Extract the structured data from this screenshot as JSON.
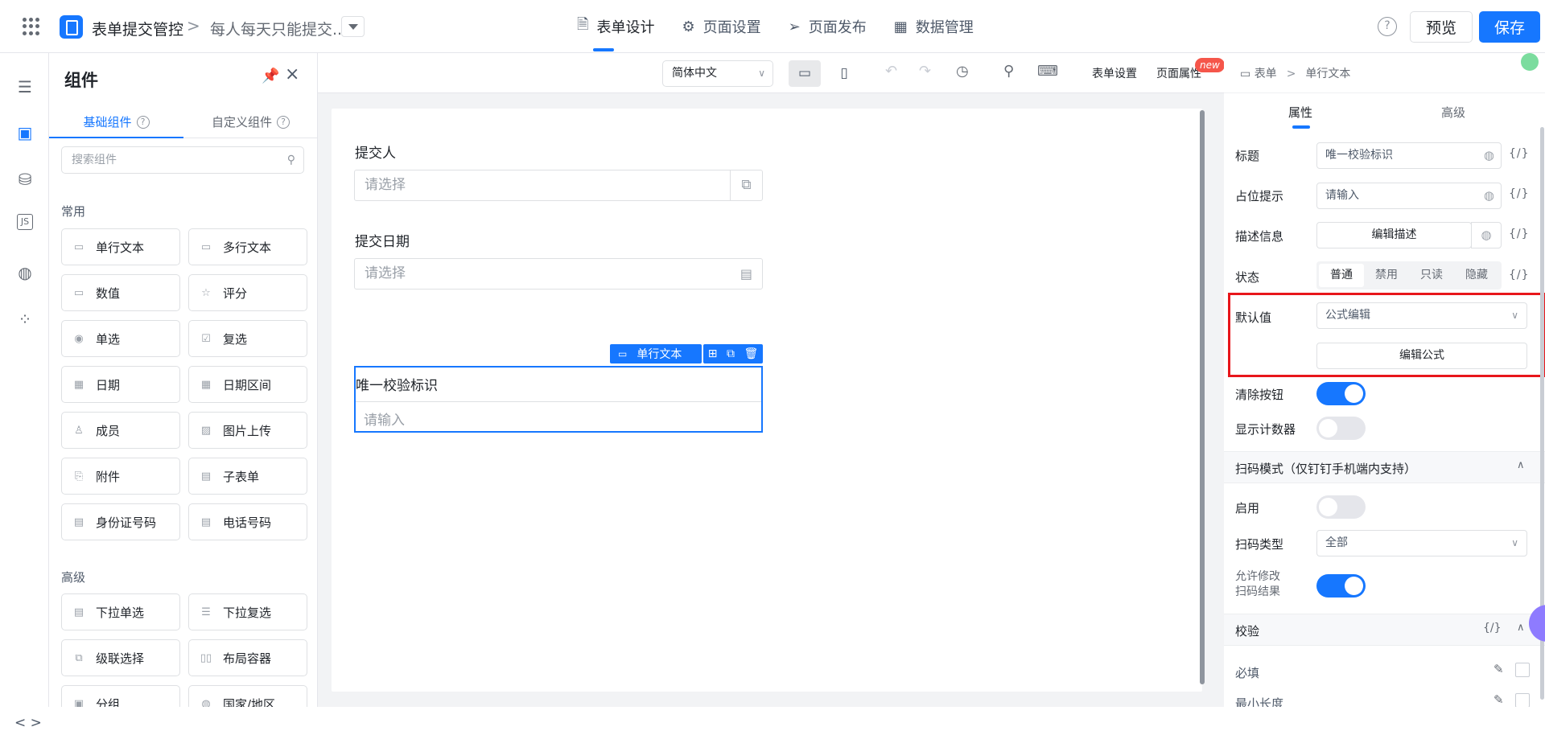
{
  "header": {
    "app_name": "表单提交管控",
    "breadcrumb_sep": ">",
    "form_name": "每人每天只能提交...",
    "tabs": [
      {
        "label": "表单设计",
        "icon": "document-icon"
      },
      {
        "label": "页面设置",
        "icon": "gear-icon"
      },
      {
        "label": "页面发布",
        "icon": "send-icon"
      },
      {
        "label": "数据管理",
        "icon": "table-icon"
      }
    ],
    "help": "?",
    "preview_label": "预览",
    "save_label": "保存",
    "accent": "#1677ff"
  },
  "rail": {
    "icons": [
      "outline-icon",
      "components-icon",
      "datasource-icon",
      "js-icon",
      "globe-icon",
      "apps-icon"
    ],
    "js_label": "JS",
    "code_label": "< >"
  },
  "panel": {
    "title": "组件",
    "tabs": [
      "基础组件",
      "自定义组件"
    ],
    "help": "?",
    "search_placeholder": "搜索组件",
    "section_common": "常用",
    "common_items": [
      {
        "label": "单行文本",
        "icon": "single-line-icon"
      },
      {
        "label": "多行文本",
        "icon": "multi-line-icon"
      },
      {
        "label": "数值",
        "icon": "number-icon"
      },
      {
        "label": "评分",
        "icon": "star-icon"
      },
      {
        "label": "单选",
        "icon": "radio-icon"
      },
      {
        "label": "复选",
        "icon": "checkbox-icon"
      },
      {
        "label": "日期",
        "icon": "calendar-icon"
      },
      {
        "label": "日期区间",
        "icon": "date-range-icon"
      },
      {
        "label": "成员",
        "icon": "member-icon"
      },
      {
        "label": "图片上传",
        "icon": "image-icon"
      },
      {
        "label": "附件",
        "icon": "attachment-icon"
      },
      {
        "label": "子表单",
        "icon": "subform-icon"
      },
      {
        "label": "身份证号码",
        "icon": "id-card-icon"
      },
      {
        "label": "电话号码",
        "icon": "phone-icon"
      }
    ],
    "section_advanced": "高级",
    "advanced_items": [
      {
        "label": "下拉单选",
        "icon": "dropdown-icon"
      },
      {
        "label": "下拉复选",
        "icon": "dropdown-multi-icon"
      },
      {
        "label": "级联选择",
        "icon": "cascade-icon"
      },
      {
        "label": "布局容器",
        "icon": "layout-icon"
      },
      {
        "label": "分组",
        "icon": "group-icon"
      },
      {
        "label": "国家/地区",
        "icon": "globe-icon"
      }
    ]
  },
  "toolbar": {
    "language": "简体中文",
    "form_settings": "表单设置",
    "page_props": "页面属性",
    "new_badge": "new"
  },
  "canvas": {
    "fields": [
      {
        "label": "提交人",
        "placeholder": "请选择"
      },
      {
        "label": "提交日期",
        "placeholder": "请选择"
      }
    ],
    "selected": {
      "tag": "单行文本",
      "title": "唯一校验标识",
      "placeholder": "请输入"
    }
  },
  "props": {
    "breadcrumb": [
      "表单",
      "单行文本"
    ],
    "tabs": [
      "属性",
      "高级"
    ],
    "fx": "{/}",
    "title_label": "标题",
    "title_value": "唯一校验标识",
    "placeholder_label": "占位提示",
    "placeholder_value": "请输入",
    "desc_label": "描述信息",
    "desc_button": "编辑描述",
    "state_label": "状态",
    "states": [
      "普通",
      "禁用",
      "只读",
      "隐藏"
    ],
    "state_selected": "普通",
    "default_label": "默认值",
    "default_value": "公式编辑",
    "edit_formula": "编辑公式",
    "clear_label": "清除按钮",
    "clear_on": true,
    "counter_label": "显示计数器",
    "counter_on": false,
    "scan_header": "扫码模式（仅钉钉手机端内支持）",
    "enable_label": "启用",
    "enable_on": false,
    "scan_type_label": "扫码类型",
    "scan_type_value": "全部",
    "allow_modify_label_1": "允许修改",
    "allow_modify_label_2": "扫码结果",
    "allow_modify_on": true,
    "validate_header": "校验",
    "required_label": "必填",
    "minlen_label": "最小长度",
    "highlight_color": "#e8161b"
  }
}
